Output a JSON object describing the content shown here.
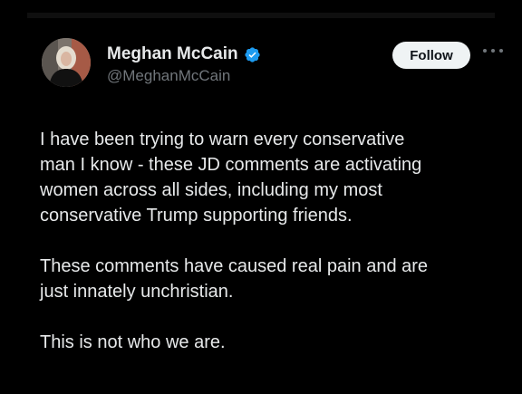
{
  "tweet": {
    "author": {
      "display_name": "Meghan McCain",
      "handle": "@MeghanMcCain",
      "verified": true,
      "avatar_icon": "profile-photo"
    },
    "actions": {
      "follow_label": "Follow",
      "more_icon": "more-icon"
    },
    "body": {
      "paragraphs": [
        {
          "lines": [
            "I have been trying to warn every conservative",
            "man I know - these JD comments are activating",
            "women across all sides, including my most",
            "conservative Trump supporting friends."
          ]
        },
        {
          "lines": [
            "These comments have caused real pain and are",
            "just innately unchristian."
          ]
        },
        {
          "lines": [
            "This is not who we are."
          ]
        }
      ]
    }
  },
  "colors": {
    "background": "#000000",
    "text_primary": "#e7e9ea",
    "text_secondary": "#71767b",
    "verified_blue": "#1d9bf0",
    "follow_bg": "#eff3f4"
  }
}
